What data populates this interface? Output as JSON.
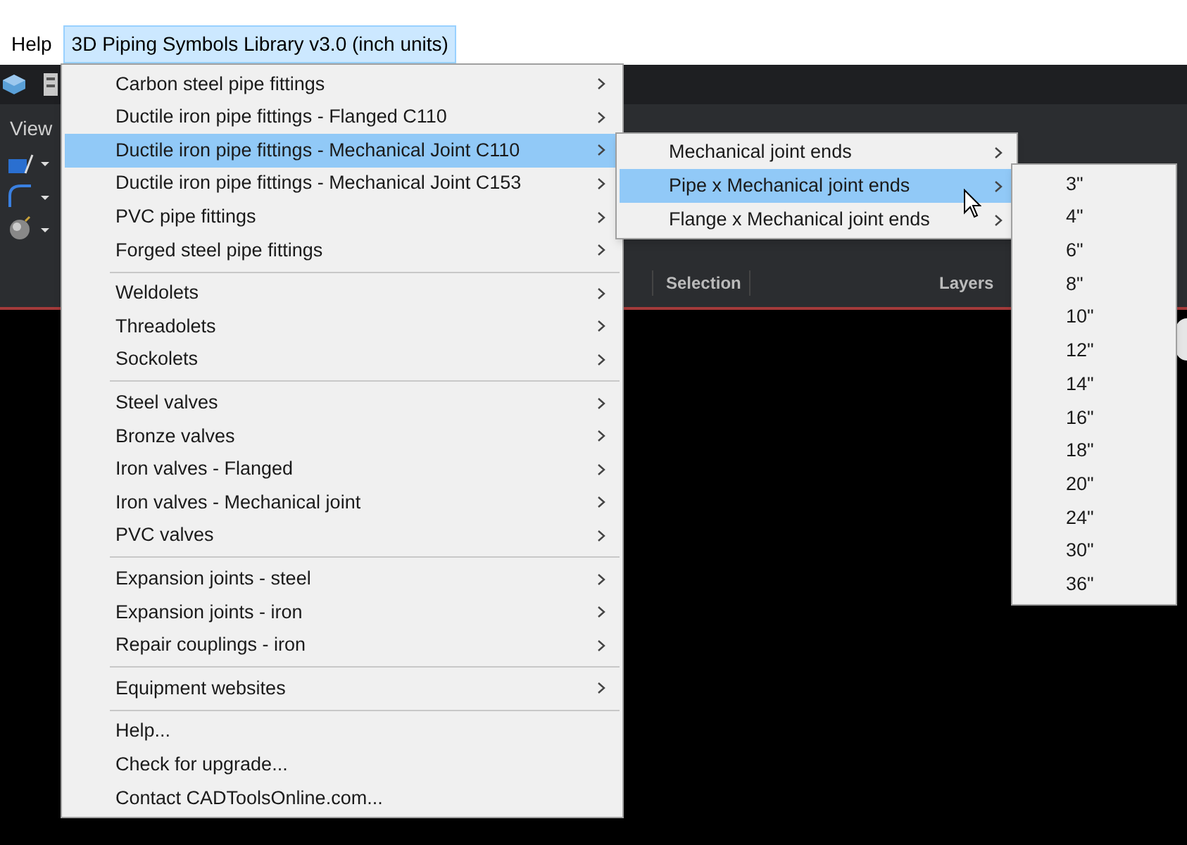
{
  "menubar": [
    {
      "label": "Help",
      "selected": false
    },
    {
      "label": "3D Piping Symbols Library v3.0 (inch units)",
      "selected": true
    }
  ],
  "app": {
    "tab": "View",
    "panels": [
      "Selection",
      "Layers"
    ]
  },
  "menu": [
    {
      "kind": "item",
      "label": "Carbon steel pipe fittings",
      "submenu": true,
      "selected": false
    },
    {
      "kind": "item",
      "label": "Ductile iron pipe fittings - Flanged C110",
      "submenu": true,
      "selected": false
    },
    {
      "kind": "item",
      "label": "Ductile iron pipe fittings - Mechanical Joint C110",
      "submenu": true,
      "selected": true,
      "children": [
        {
          "label": "Mechanical joint ends",
          "submenu": true,
          "selected": false
        },
        {
          "label": "Pipe x Mechanical joint ends",
          "submenu": true,
          "selected": true,
          "children": [
            {
              "label": "3\"",
              "selected": false
            },
            {
              "label": "4\"",
              "selected": false
            },
            {
              "label": "6\"",
              "selected": false
            },
            {
              "label": "8\"",
              "selected": false
            },
            {
              "label": "10\"",
              "selected": false
            },
            {
              "label": "12\"",
              "selected": false
            },
            {
              "label": "14\"",
              "selected": false
            },
            {
              "label": "16\"",
              "selected": false
            },
            {
              "label": "18\"",
              "selected": false
            },
            {
              "label": "20\"",
              "selected": false
            },
            {
              "label": "24\"",
              "selected": false
            },
            {
              "label": "30\"",
              "selected": false
            },
            {
              "label": "36\"",
              "selected": false
            }
          ]
        },
        {
          "label": "Flange x Mechanical joint ends",
          "submenu": true,
          "selected": false
        }
      ]
    },
    {
      "kind": "item",
      "label": "Ductile iron pipe fittings - Mechanical Joint C153",
      "submenu": true,
      "selected": false
    },
    {
      "kind": "item",
      "label": "PVC pipe fittings",
      "submenu": true,
      "selected": false
    },
    {
      "kind": "item",
      "label": "Forged steel pipe fittings",
      "submenu": true,
      "selected": false
    },
    {
      "kind": "separator"
    },
    {
      "kind": "item",
      "label": "Weldolets",
      "submenu": true,
      "selected": false
    },
    {
      "kind": "item",
      "label": "Threadolets",
      "submenu": true,
      "selected": false
    },
    {
      "kind": "item",
      "label": "Sockolets",
      "submenu": true,
      "selected": false
    },
    {
      "kind": "separator"
    },
    {
      "kind": "item",
      "label": "Steel valves",
      "submenu": true,
      "selected": false
    },
    {
      "kind": "item",
      "label": "Bronze valves",
      "submenu": true,
      "selected": false
    },
    {
      "kind": "item",
      "label": "Iron valves - Flanged",
      "submenu": true,
      "selected": false
    },
    {
      "kind": "item",
      "label": "Iron valves - Mechanical joint",
      "submenu": true,
      "selected": false
    },
    {
      "kind": "item",
      "label": "PVC valves",
      "submenu": true,
      "selected": false
    },
    {
      "kind": "separator"
    },
    {
      "kind": "item",
      "label": "Expansion joints - steel",
      "submenu": true,
      "selected": false
    },
    {
      "kind": "item",
      "label": "Expansion joints - iron",
      "submenu": true,
      "selected": false
    },
    {
      "kind": "item",
      "label": "Repair couplings - iron",
      "submenu": true,
      "selected": false
    },
    {
      "kind": "separator"
    },
    {
      "kind": "item",
      "label": "Equipment websites",
      "submenu": true,
      "selected": false
    },
    {
      "kind": "separator"
    },
    {
      "kind": "item",
      "label": "Help...",
      "submenu": false,
      "selected": false
    },
    {
      "kind": "item",
      "label": "Check for upgrade...",
      "submenu": false,
      "selected": false
    },
    {
      "kind": "item",
      "label": "Contact CADToolsOnline.com...",
      "submenu": false,
      "selected": false
    }
  ]
}
